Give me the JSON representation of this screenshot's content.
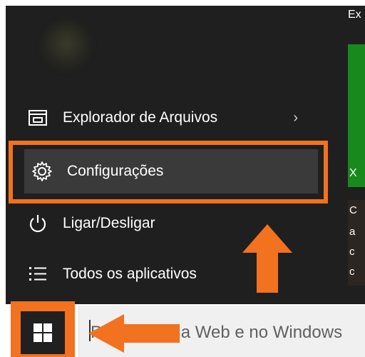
{
  "start_menu": {
    "items": [
      {
        "label": "Explorador de Arquivos",
        "icon": "file-explorer-icon",
        "chevron": "›"
      },
      {
        "label": "Configurações",
        "icon": "gear-icon"
      },
      {
        "label": "Ligar/Desligar",
        "icon": "power-icon"
      },
      {
        "label": "Todos os aplicativos",
        "icon": "all-apps-icon"
      }
    ]
  },
  "tiles": {
    "header": "Ex",
    "green_tile_label": "X",
    "news_tile_letters": [
      "C",
      "a",
      "c",
      "c"
    ]
  },
  "taskbar": {
    "search_placeholder": "Pesquisar na Web e no Windows"
  },
  "colors": {
    "accent": "#f2721f",
    "menu_bg": "#1f1f1f",
    "selected_bg": "#3a3a3a",
    "tile_green": "#17891d"
  }
}
